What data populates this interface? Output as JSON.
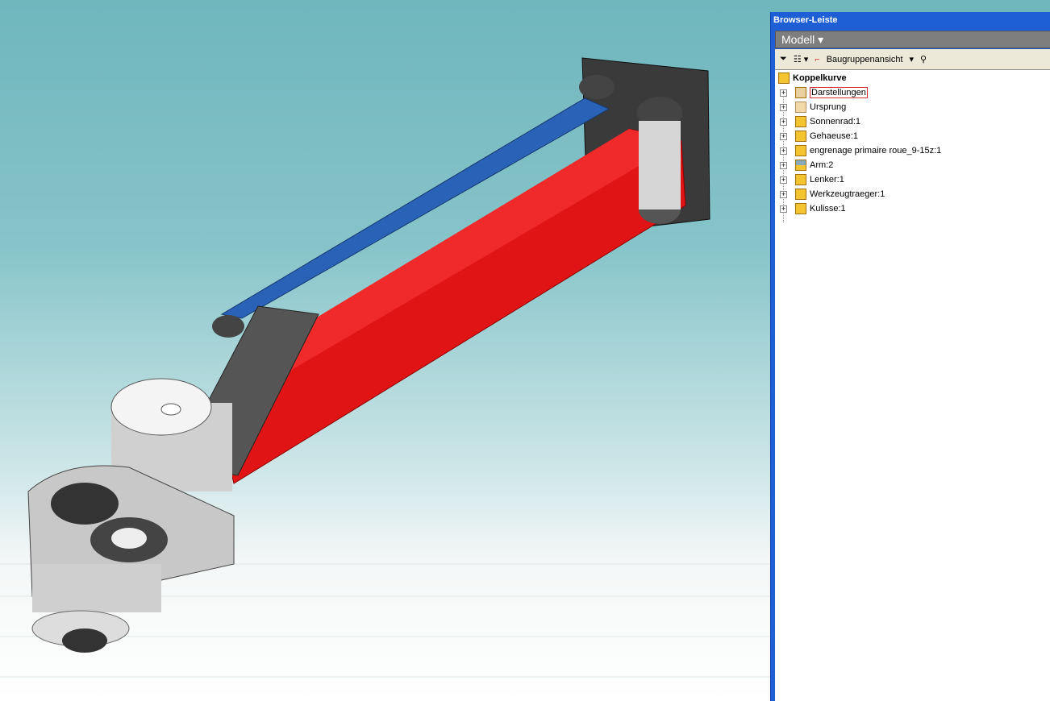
{
  "panel": {
    "title": "Browser-Leiste",
    "dropdown_label": "Modell ▾",
    "toolbar": {
      "filter_icon": "filter-icon",
      "tree_icon": "tree-view-icon",
      "view_label": "Baugruppenansicht",
      "find_icon": "binoculars-icon"
    },
    "root": "Koppelkurve",
    "items": [
      {
        "label": "Darstellungen",
        "icon": "representations-icon"
      },
      {
        "label": "Ursprung",
        "icon": "folder-icon"
      },
      {
        "label": "Sonnenrad:1",
        "icon": "part-pinned-icon"
      },
      {
        "label": "Gehaeuse:1",
        "icon": "part-icon"
      },
      {
        "label": "engrenage primaire roue_9-15z:1",
        "icon": "part-icon"
      },
      {
        "label": "Arm:2",
        "icon": "assembly-icon"
      },
      {
        "label": "Lenker:1",
        "icon": "part-icon"
      },
      {
        "label": "Werkzeugtraeger:1",
        "icon": "part-icon"
      },
      {
        "label": "Kulisse:1",
        "icon": "part-icon"
      }
    ]
  }
}
